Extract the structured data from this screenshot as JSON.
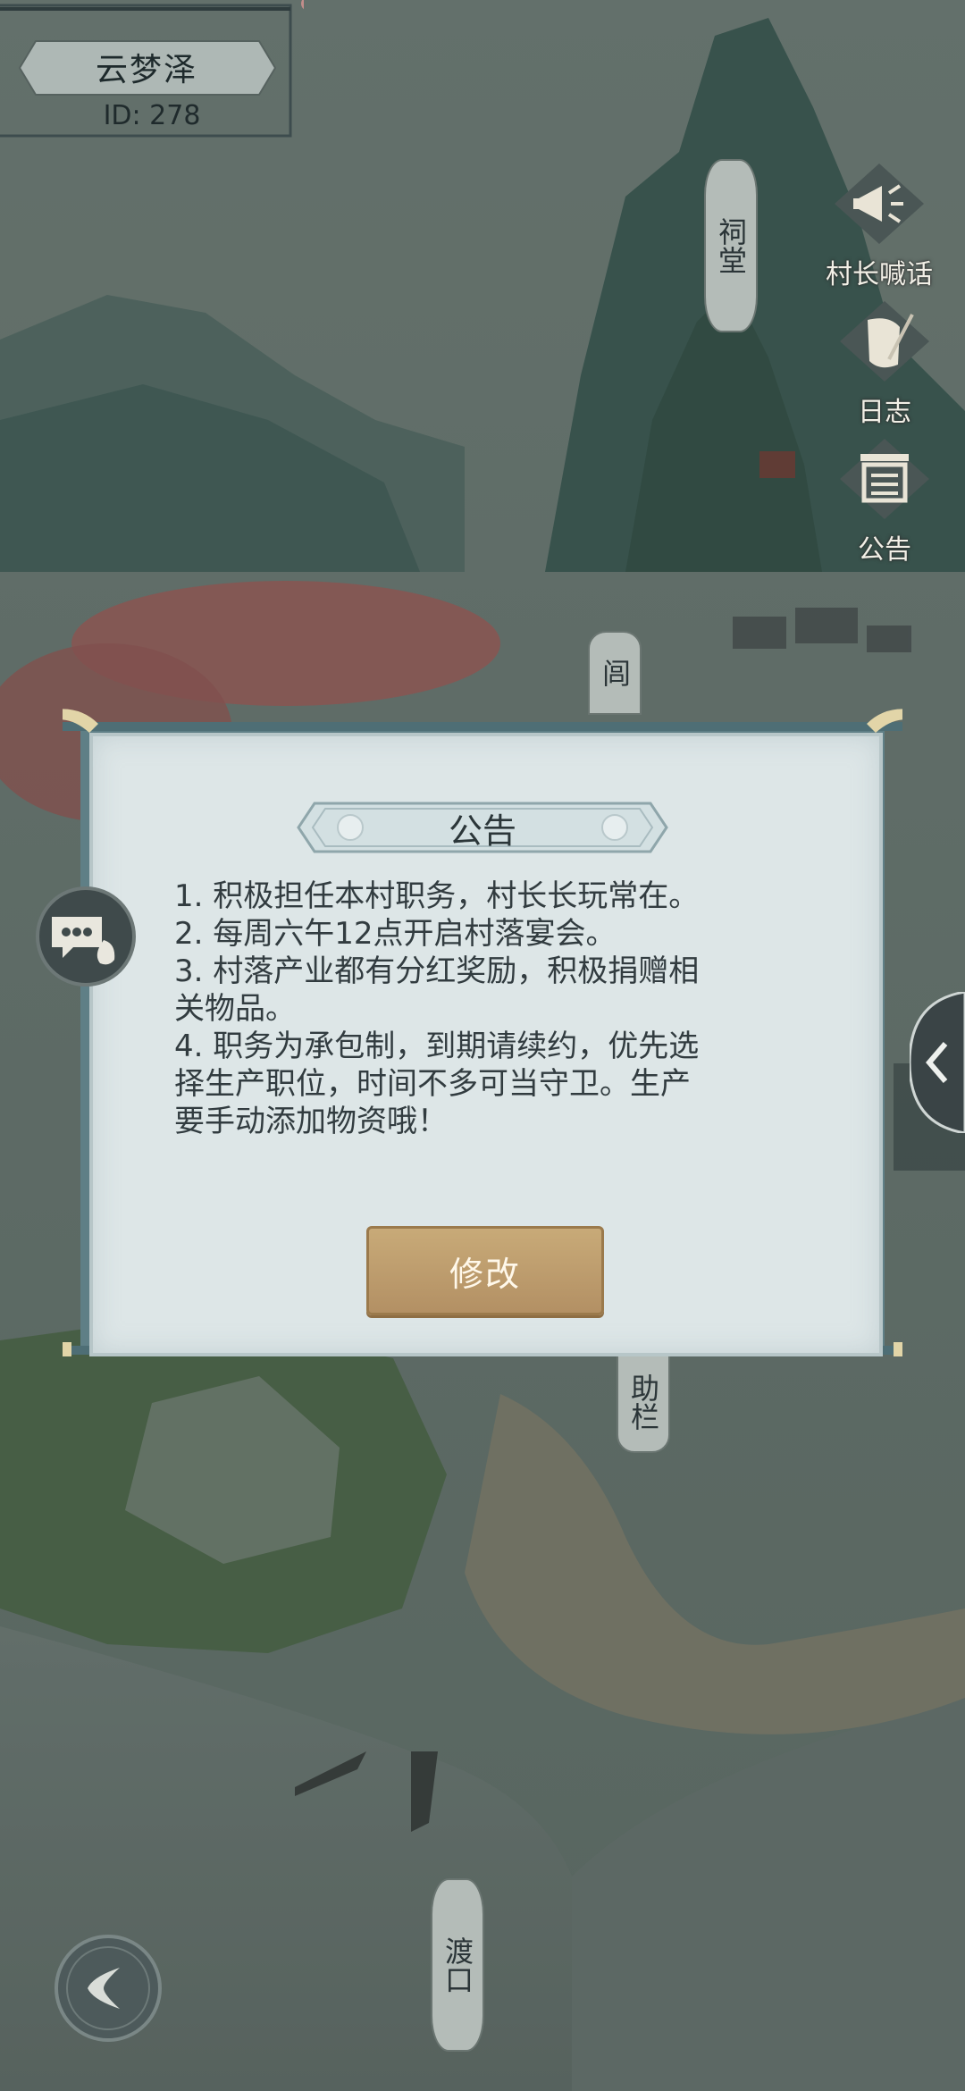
{
  "village": {
    "name": "云梦泽",
    "id_label": "ID: 278"
  },
  "map_labels": {
    "ancestral_hall": "祠堂",
    "lane": "闾",
    "fence": "助栏",
    "ferry": "渡口"
  },
  "side_buttons": [
    {
      "label": "村长喊话",
      "icon": "megaphone-icon"
    },
    {
      "label": "日志",
      "icon": "scroll-quill-icon"
    },
    {
      "label": "公告",
      "icon": "notice-board-icon"
    }
  ],
  "notice": {
    "title": "公告",
    "lines": [
      "1. 积极担任本村职务，村长长玩常在。",
      "2. 每周六午12点开启村落宴会。",
      "3. 村落产业都有分红奖励，积极捐赠相",
      "关物品。",
      "4. 职务为承包制，到期请续约，优先选",
      "择生产职位，时间不多可当守卫。生产",
      "要手动添加物资哦！"
    ],
    "edit_label": "修改"
  },
  "colors": {
    "accent_gold": "#b8966a",
    "panel_bg": "#dde6e7",
    "frame_teal": "#5f7f86"
  }
}
